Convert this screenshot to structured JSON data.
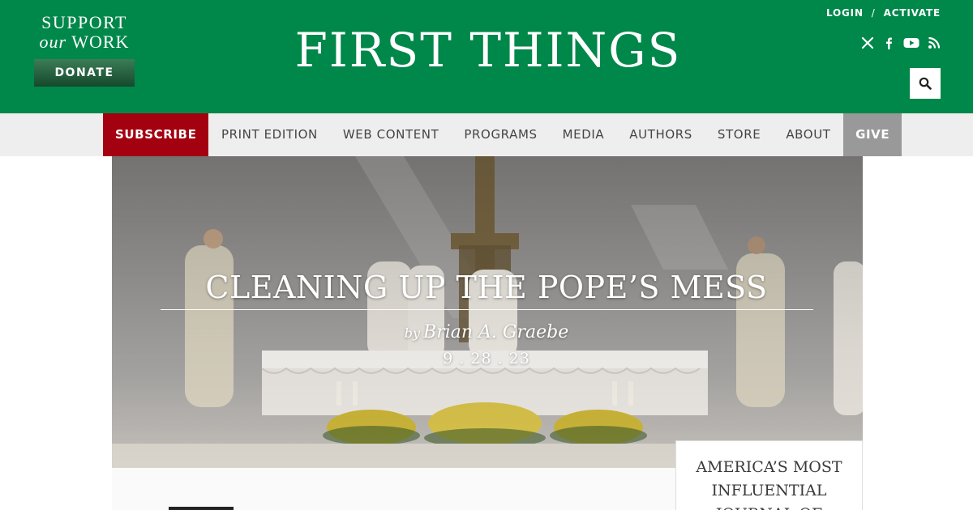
{
  "header": {
    "support_line1": "SUPPORT",
    "support_line2_italic": "our",
    "support_line2_rest": "WORK",
    "donate_label": "DONATE",
    "site_title": "FIRST THINGS",
    "login_label": "LOGIN",
    "separator": "/",
    "activate_label": "ACTIVATE",
    "social_icons": [
      "x-icon",
      "facebook-icon",
      "youtube-icon",
      "rss-icon"
    ]
  },
  "nav": {
    "items": [
      {
        "label": "SUBSCRIBE",
        "highlight": "#a30010"
      },
      {
        "label": "PRINT EDITION"
      },
      {
        "label": "WEB CONTENT"
      },
      {
        "label": "PROGRAMS"
      },
      {
        "label": "MEDIA"
      },
      {
        "label": "AUTHORS"
      },
      {
        "label": "STORE"
      },
      {
        "label": "ABOUT"
      },
      {
        "label": "GIVE",
        "highlight": "#999999"
      }
    ]
  },
  "article": {
    "title": "CLEANING UP THE POPE’S MESS",
    "by": "by",
    "author": "Brian A. Graebe",
    "date": "9 . 28 . 23"
  },
  "promo": {
    "text_line1": "AMERICA’S MOST",
    "text_line2": "INFLUENTIAL",
    "text_line3": "JOURNAL OF"
  },
  "colors": {
    "brand_green": "#00874a",
    "subscribe_red": "#a30010",
    "give_gray": "#999999"
  }
}
